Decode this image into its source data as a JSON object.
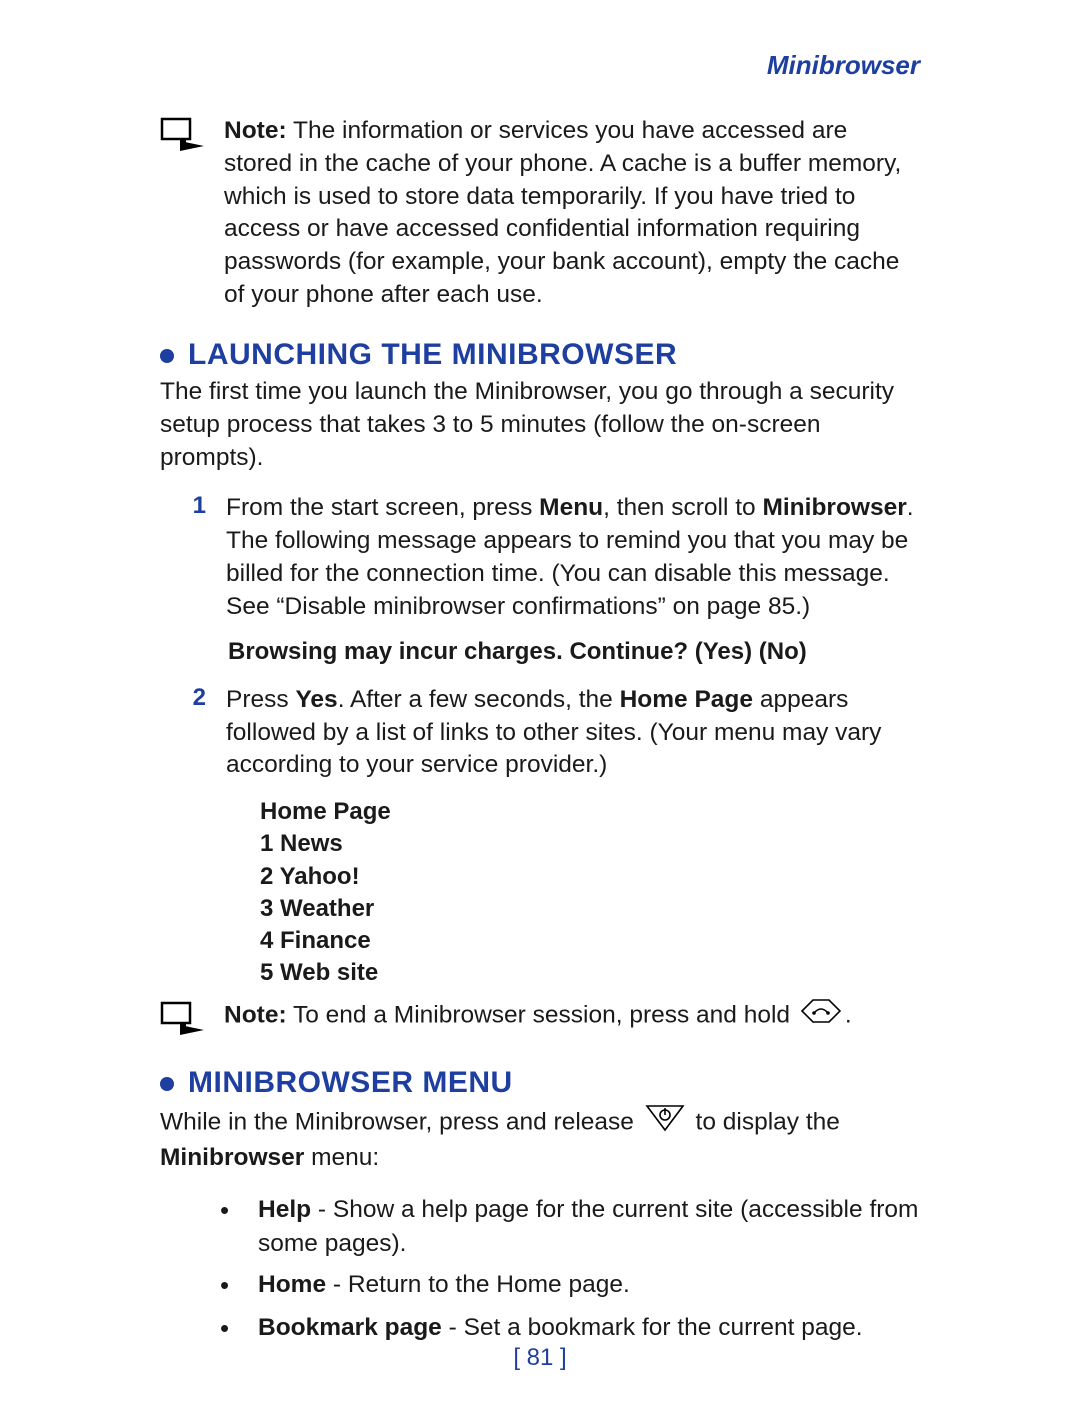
{
  "running_head": "Minibrowser",
  "note1": {
    "label": "Note:",
    "body": "The information or services you have accessed are stored in the cache of your phone. A cache is a buffer memory, which is used to store data temporarily. If you have tried to access or have accessed confidential information requiring passwords (for example, your bank account), empty the cache of your phone after each use."
  },
  "section1": {
    "title": "LAUNCHING THE MINIBROWSER",
    "intro": "The first time you launch the Minibrowser, you go through a security setup process that takes 3 to 5 minutes (follow the on-screen prompts).",
    "step1": {
      "num": "1",
      "pre": "From the start screen, press ",
      "menu": "Menu",
      "mid": ", then scroll to ",
      "mini": "Minibrowser",
      "post": ". The following message appears to remind you that you may be billed for the connection time. (You can disable this message. See “Disable minibrowser confirmations” on page 85.)",
      "prompt": "Browsing may incur charges. Continue? (Yes) (No)"
    },
    "step2": {
      "num": "2",
      "pre": "Press ",
      "yes": "Yes",
      "mid1": ". After a few seconds, the ",
      "homepage": "Home Page",
      "post": " appears followed by a list of links to other sites. (Your menu may vary according to your service provider.)",
      "menu_lines": {
        "l0": "Home Page",
        "l1": "1 News",
        "l2": "2 Yahoo!",
        "l3": "3 Weather",
        "l4": "4 Finance",
        "l5": "5 Web site"
      }
    },
    "note2": {
      "label": "Note:",
      "body_pre": "To end a Minibrowser session, press and hold ",
      "body_post": "."
    }
  },
  "section2": {
    "title": "MINIBROWSER MENU",
    "intro_pre": "While in the Minibrowser, press and release ",
    "intro_mid": " to display the ",
    "intro_bold": "Minibrowser",
    "intro_post": " menu:",
    "items": {
      "help": {
        "label": "Help",
        "text": " - Show a help page for the current site (accessible from some pages)."
      },
      "home": {
        "label": "Home",
        "text": " - Return to the Home page."
      },
      "bookmark": {
        "label": "Bookmark page",
        "text": " - Set a bookmark for the current page."
      }
    }
  },
  "page_number": "[ 81 ]"
}
